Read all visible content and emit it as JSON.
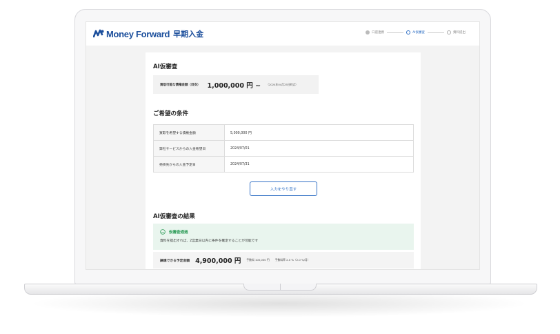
{
  "header": {
    "brand": "Money Forward",
    "product": "早期入金",
    "steps": [
      {
        "label": "口座連携",
        "state": "done"
      },
      {
        "label": "AI仮審査",
        "state": "active"
      },
      {
        "label": "資料提出",
        "state": "todo"
      }
    ]
  },
  "ai_review": {
    "title": "AI仮審査",
    "limit_label": "買取可能な債権金額（目安）",
    "limit_amount": "1,000,000 円 ~",
    "limit_note": "（2024年04月25日時点）"
  },
  "conditions": {
    "title": "ご希望の条件",
    "rows": [
      {
        "key": "買取を希望する債権金額",
        "value": "5,000,000 円"
      },
      {
        "key": "弊社サービスからの入金希望日",
        "value": "2024/07/01"
      },
      {
        "key": "売掛先からの入金予定日",
        "value": "2024/07/31"
      }
    ],
    "redo_button": "入力をやり直す"
  },
  "result": {
    "title": "AI仮審査の結果",
    "status_title": "仮審査通過",
    "status_desc": "資料を提出すれば、2営業日以内に条件を確定することが可能です",
    "fund_label": "調達できる予定金額",
    "fund_amount": "4,900,000 円",
    "fee": "手数料 100,000 円",
    "fee_rate": "手数料率 2.0 %（2.0 %/月）"
  },
  "colors": {
    "brand": "#1c4f9c",
    "accent": "#2f6fc4",
    "success": "#2a9a55"
  }
}
